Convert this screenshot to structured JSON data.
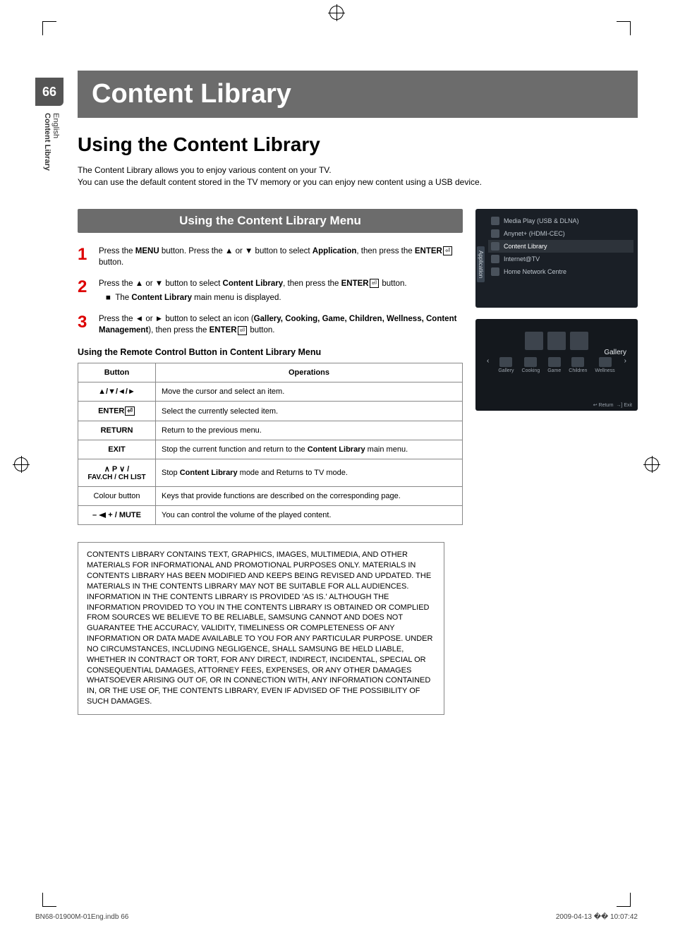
{
  "page_number": "66",
  "side": {
    "language": "English",
    "section": "Content Library"
  },
  "title_bar": "Content Library",
  "section_heading": "Using the Content Library",
  "intro_lines": [
    "The Content Library allows you to enjoy various content on your TV.",
    "You can use the default content stored in the TV memory or you can enjoy new content using a USB device."
  ],
  "inner_heading": "Using the Content Library Menu",
  "steps": [
    {
      "num": "1",
      "pre": "Press the ",
      "b1": "MENU",
      "mid1": " button. Press the ▲ or ▼ button to select ",
      "b2": "Application",
      "mid2": ", then press the ",
      "b3": "ENTER",
      "post": " button."
    },
    {
      "num": "2",
      "pre": "Press the ▲ or ▼ button to select ",
      "b1": "Content Library",
      "mid1": ", then press the ",
      "b2": "ENTER",
      "post": " button.",
      "bullet_pre": "The ",
      "bullet_b": "Content Library",
      "bullet_post": " main menu is displayed."
    },
    {
      "num": "3",
      "pre": "Press the ◄ or ► button to select an icon (",
      "b1": "Gallery, Cooking, Game, Children, Wellness, Content Management",
      "mid1": "), then press the ",
      "b2": "ENTER",
      "post": " button."
    }
  ],
  "subheading": "Using the Remote Control Button in Content Library Menu",
  "table": {
    "headers": [
      "Button",
      "Operations"
    ],
    "rows": [
      {
        "button": "▲/▼/◄/►",
        "op": "Move the cursor and select an item."
      },
      {
        "button_bold": "ENTER",
        "button_icon": true,
        "op": "Select the currently selected item."
      },
      {
        "button_bold": "RETURN",
        "op": "Return to the previous menu."
      },
      {
        "button_bold": "EXIT",
        "op_pre": "Stop the current function and return to the ",
        "op_b": "Content Library",
        "op_post": " main menu."
      },
      {
        "button_html": "pvfav",
        "op_pre": "Stop ",
        "op_b": "Content Library",
        "op_post": " mode and Returns to TV mode."
      },
      {
        "button_plain": "Colour button",
        "op": "Keys that provide functions are described on the corresponding page."
      },
      {
        "button_html": "volmute",
        "op": "You can control the volume of the played content."
      }
    ],
    "pv_line1_sym": "∧ P ∨ /",
    "pv_line2": "FAV.CH / CH LIST",
    "volmute_suffix": " / MUTE",
    "volmute_minus": "– ",
    "volmute_plus": " +"
  },
  "disclaimer": "CONTENTS LIBRARY CONTAINS TEXT, GRAPHICS, IMAGES, MULTIMEDIA, AND OTHER MATERIALS FOR INFORMATIONAL AND PROMOTIONAL PURPOSES ONLY. MATERIALS IN CONTENTS LIBRARY HAS BEEN MODIFIED AND KEEPS BEING REVISED AND UPDATED. THE MATERIALS IN THE CONTENTS LIBRARY MAY NOT BE SUITABLE FOR ALL AUDIENCES.\nINFORMATION IN THE CONTENTS LIBRARY IS PROVIDED 'AS IS.' ALTHOUGH THE INFORMATION PROVIDED TO YOU IN THE CONTENTS LIBRARY IS OBTAINED OR COMPLIED FROM SOURCES WE BELIEVE TO BE RELIABLE, SAMSUNG CANNOT AND DOES NOT GUARANTEE THE ACCURACY, VALIDITY, TIMELINESS OR COMPLETENESS\nOF ANY INFORMATION OR DATA MADE AVAILABLE TO YOU FOR ANY PARTICULAR PURPOSE. UNDER NO CIRCUMSTANCES, INCLUDING NEGLIGENCE, SHALL SAMSUNG BE HELD LIABLE, WHETHER IN CONTRACT OR TORT, FOR ANY DIRECT, INDIRECT, INCIDENTAL, SPECIAL OR CONSEQUENTIAL DAMAGES, ATTORNEY FEES, EXPENSES, OR ANY OTHER DAMAGES WHATSOEVER ARISING OUT OF, OR IN CONNECTION WITH, ANY INFORMATION CONTAINED IN, OR THE USE OF, THE CONTENTS LIBRARY, EVEN IF ADVISED OF THE POSSIBILITY OF SUCH DAMAGES.",
  "osd1": {
    "tab": "Application",
    "items": [
      "Media Play (USB & DLNA)",
      "Anynet+ (HDMI-CEC)",
      "Content Library",
      "Internet@TV",
      "Home Network Centre"
    ]
  },
  "osd2": {
    "label": "Gallery",
    "categories": [
      "Gallery",
      "Cooking",
      "Game",
      "Children",
      "Wellness"
    ],
    "footer_return": "Return",
    "footer_exit": "Exit"
  },
  "footer": {
    "left": "BN68-01900M-01Eng.indb   66",
    "right": "2009-04-13   �� 10:07:42"
  }
}
